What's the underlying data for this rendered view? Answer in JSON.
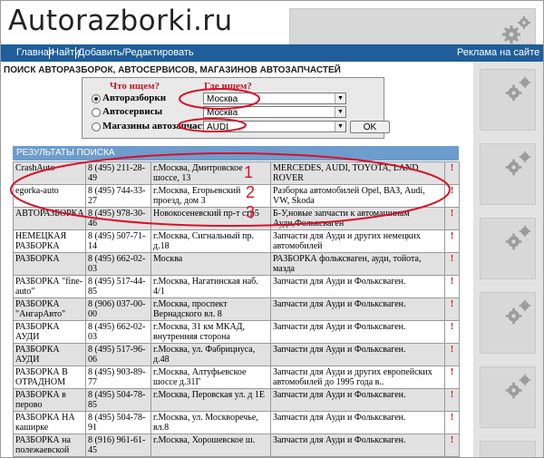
{
  "site": {
    "logo": "Autorazborki.ru"
  },
  "nav": {
    "items": [
      "Главная",
      "Найти",
      "Добавить/Редактировать"
    ],
    "ads_label": "Реклама на сайте"
  },
  "heading": "ПОИСК АВТОРАЗБОРОК, АВТОСЕРВИСОВ, МАГАЗИНОВ АВТОЗАПЧАСТЕЙ",
  "search": {
    "what_label": "Что ищем?",
    "where_label": "Где ищем?",
    "options": [
      {
        "label": "Авторазборки",
        "selected": true,
        "value": "Москва"
      },
      {
        "label": "Автосервисы",
        "selected": false,
        "value": "Москва"
      },
      {
        "label": "Магазины автозапчастей",
        "selected": false,
        "value": "AUDI"
      }
    ],
    "ok_label": "OK"
  },
  "results": {
    "title": "РЕЗУЛЬТАТЫ ПОИСКА",
    "rows": [
      {
        "name": "CrashAuto",
        "phone": "8 (495) 211-28-49",
        "address": "г.Москва, Дмитровское шоссе, 13",
        "desc": "MERCEDES, AUDI, TOYOTA, LAND ROVER",
        "mark": "!"
      },
      {
        "name": "egorka-auto",
        "phone": "8 (495) 744-33-27",
        "address": "г.Москва, Егорьевский проезд, дом 3",
        "desc": "Разборка автомобилей Opel, ВАЗ, Audi, VW, Skoda",
        "mark": "!"
      },
      {
        "name": "АВТОРАЗБОРКА",
        "phone": "8 (495) 978-30-46",
        "address": "Новокосеневский пр-т стр5",
        "desc": "Б-У,новые запчасти к автомашинам Ауди,Фольксваген",
        "mark": "!"
      },
      {
        "name": "НЕМЕЦКАЯ РАЗБОРКА",
        "phone": "8 (495) 507-71-14",
        "address": "г.Москва, Сигнальный пр. д.18",
        "desc": "Запчасти для Ауди и других немецких автомобилей",
        "mark": "!"
      },
      {
        "name": "РАЗБОРКА",
        "phone": "8 (495) 662-02-03",
        "address": "Москва",
        "desc": "РАЗБОРКА фольксваген, ауди, тойота, мазда",
        "mark": "!"
      },
      {
        "name": "РАЗБОРКА \"fine-auto\"",
        "phone": "8 (495) 517-44-85",
        "address": "г.Москва, Нагатинская наб. 4/1",
        "desc": "Запчасти для Ауди и Фольксваген.",
        "mark": "!"
      },
      {
        "name": "РАЗБОРКА \"АнгарАвто\"",
        "phone": "8 (906) 037-00-00",
        "address": "г.Москва, проспект Вернадского вл. 8",
        "desc": "Запчасти для Ауди и Фольксваген.",
        "mark": "!"
      },
      {
        "name": "РАЗБОРКА АУДИ",
        "phone": "8 (495) 662-02-03",
        "address": "г.Москва, 31 км МКАД, внутренняя сторона",
        "desc": "Запчасти для Ауди и Фольксваген.",
        "mark": "!"
      },
      {
        "name": "РАЗБОРКА АУДИ",
        "phone": "8 (495) 517-96-06",
        "address": "г.Москва, ул. Фабрициуса, д.48",
        "desc": "Запчасти для Ауди и Фольксваген.",
        "mark": "!"
      },
      {
        "name": "РАЗБОРКА В ОТРАДНОМ",
        "phone": "8 (495) 903-89-77",
        "address": "г.Москва, Алтуфьевское шоссе д.31Г",
        "desc": "Запчасти для Ауди и других европейских автомобилей до 1995 года в..",
        "mark": "!"
      },
      {
        "name": "РАЗБОРКА в перово",
        "phone": "8 (495) 504-78-85",
        "address": "г.Москва, Перовская ул. д 1Е",
        "desc": "Запчасти для Ауди и Фольксваген.",
        "mark": "!"
      },
      {
        "name": "РАЗБОРКА НА каширке",
        "phone": "8 (495) 504-78-91",
        "address": "г.Москва, ул. Москворечье, вл.8",
        "desc": "Запчасти для Ауди и Фольксваген.",
        "mark": "!"
      },
      {
        "name": "РАЗБОРКА на полежаевской",
        "phone": "8 (916) 961-61-45",
        "address": "г.Москва, Хорошевское ш.",
        "desc": "Запчасти для Ауди и Фольксваген.",
        "mark": "!"
      }
    ]
  },
  "annotations": [
    "1",
    "2",
    "3"
  ],
  "colors": {
    "nav_bg": "#1f5e9a",
    "results_head": "#6e9ccc",
    "accent_red": "#d9102a",
    "row_gray": "#e1e1e1"
  },
  "icons": [
    "gear-icon",
    "chevron-down-icon",
    "exclamation-icon"
  ]
}
